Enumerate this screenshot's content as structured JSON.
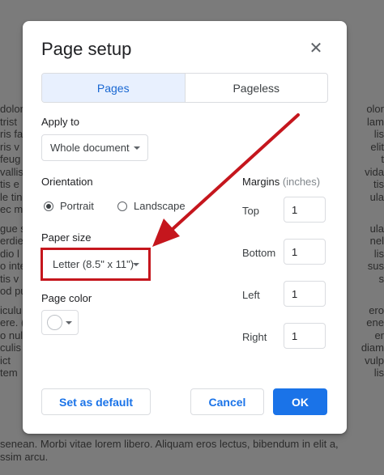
{
  "background_doc": {
    "left_lines": [
      "dolor",
      "trist",
      "ris fa",
      "ris v",
      "feug",
      "vallis",
      "tis e",
      "le tin",
      "ec ma",
      "gue s",
      "erdie",
      "dio l",
      "o inte",
      "tis v",
      "od pu",
      "iculu",
      "ere. (",
      "o null",
      "culis",
      "ict",
      "tem"
    ],
    "right_lines": [
      "olor",
      "lam",
      "lis",
      "elit",
      "t",
      "vida",
      "tis",
      "ula",
      "",
      "ula",
      "nel",
      "lis",
      "sus",
      "s",
      "",
      "ero",
      "ene",
      "er",
      "diam",
      "vulp",
      "lis"
    ],
    "bottom_lines": [
      "senean. Morbi vitae lorem libero. Aliquam eros lectus, bibendum in elit a,",
      "ssim arcu."
    ]
  },
  "dialog": {
    "title": "Page setup",
    "close_icon": "close-icon",
    "tabs": [
      {
        "label": "Pages",
        "active": true
      },
      {
        "label": "Pageless",
        "active": false
      }
    ],
    "apply_to": {
      "label": "Apply to",
      "value": "Whole document"
    },
    "orientation": {
      "label": "Orientation",
      "options": [
        {
          "label": "Portrait",
          "checked": true
        },
        {
          "label": "Landscape",
          "checked": false
        }
      ]
    },
    "paper_size": {
      "label": "Paper size",
      "value": "Letter (8.5\" x 11\")"
    },
    "page_color": {
      "label": "Page color",
      "value": "#ffffff"
    },
    "margins": {
      "label": "Margins",
      "unit": "(inches)",
      "fields": [
        {
          "label": "Top",
          "value": "1"
        },
        {
          "label": "Bottom",
          "value": "1"
        },
        {
          "label": "Left",
          "value": "1"
        },
        {
          "label": "Right",
          "value": "1"
        }
      ]
    },
    "buttons": {
      "set_default": "Set as default",
      "cancel": "Cancel",
      "ok": "OK"
    }
  },
  "colors": {
    "accent": "#1a73e8",
    "annotation": "#c5161d",
    "tab_active_bg": "#e8f0fe"
  }
}
